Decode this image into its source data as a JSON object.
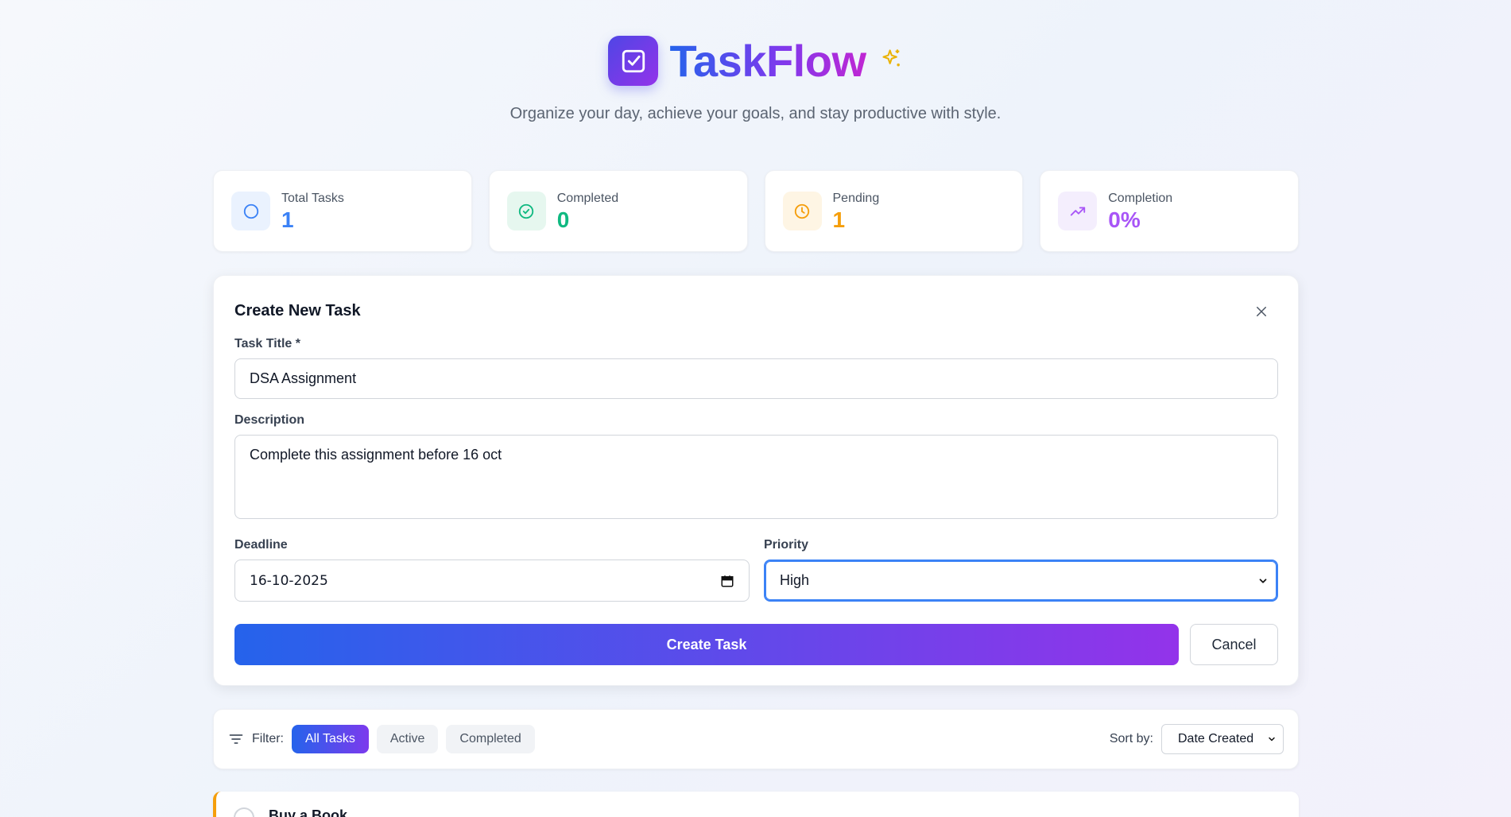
{
  "app": {
    "title": "TaskFlow",
    "tagline": "Organize your day, achieve your goals, and stay productive with style."
  },
  "stats": [
    {
      "label": "Total Tasks",
      "value": "1",
      "color": "#3b82f6",
      "icon": "circle-icon"
    },
    {
      "label": "Completed",
      "value": "0",
      "color": "#10b981",
      "icon": "check-circle-icon"
    },
    {
      "label": "Pending",
      "value": "1",
      "color": "#f59e0b",
      "icon": "clock-icon"
    },
    {
      "label": "Completion",
      "value": "0%",
      "color": "#a855f7",
      "icon": "trending-up-icon"
    }
  ],
  "form": {
    "title": "Create New Task",
    "title_label": "Task Title *",
    "title_value": "DSA Assignment",
    "description_label": "Description",
    "description_value": "Complete this assignment before 16 oct",
    "deadline_label": "Deadline",
    "deadline_value": "16-10-2025",
    "priority_label": "Priority",
    "priority_value": "High",
    "create_label": "Create Task",
    "cancel_label": "Cancel"
  },
  "filter": {
    "label": "Filter:",
    "options": [
      "All Tasks",
      "Active",
      "Completed"
    ],
    "active": "All Tasks",
    "sort_label": "Sort by:",
    "sort_value": "Date Created"
  },
  "tasks": [
    {
      "title": "Buy a Book",
      "priority_color": "#f59e0b"
    }
  ]
}
